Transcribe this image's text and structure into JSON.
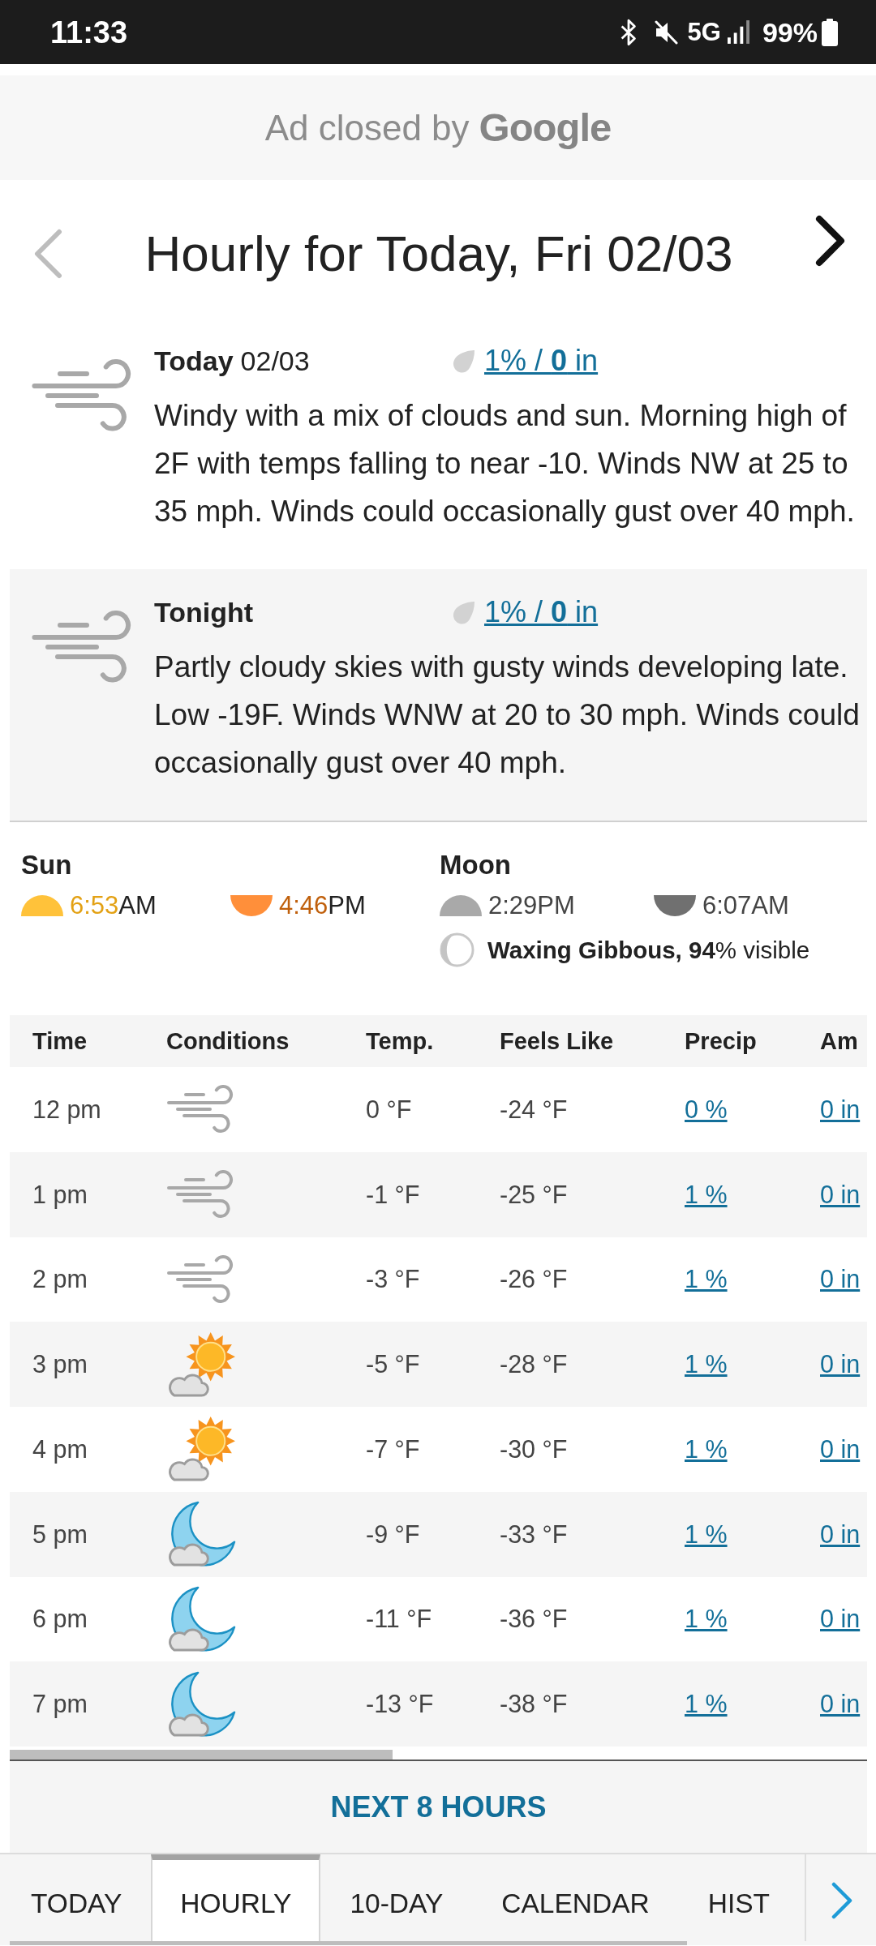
{
  "status_bar": {
    "time": "11:33",
    "network": "5G",
    "battery": "99%"
  },
  "ad_notice": {
    "text": "Ad closed by",
    "brand": "Google"
  },
  "header": {
    "title": "Hourly for Today, Fri 02/03"
  },
  "periods": [
    {
      "kind": "wind",
      "name": "Today",
      "date": "02/03",
      "precip": "1% / **0** in",
      "description": "Windy with a mix of clouds and sun. Morning high of 2F with temps falling to near -10. Winds NW at 25 to 35 mph. Winds could occasionally gust over 40 mph."
    },
    {
      "kind": "wind",
      "name": "Tonight",
      "precip": "1% / **0** in",
      "description": "Partly cloudy skies with gusty winds developing late. Low -19F. Winds WNW at 20 to 30 mph. Winds could occasionally gust over 40 mph."
    }
  ],
  "sun": {
    "title": "Sun",
    "rise": {
      "time": "6:53",
      "suffix": "AM"
    },
    "set": {
      "time": "4:46",
      "suffix": "PM"
    }
  },
  "moon": {
    "title": "Moon",
    "rise": {
      "time": "2:29",
      "suffix": "PM"
    },
    "set": {
      "time": "6:07",
      "suffix": "AM"
    },
    "phase": "**Waxing Gibbous, 94**% visible"
  },
  "table": {
    "columns": [
      "Time",
      "Conditions",
      "Temp.",
      "Feels Like",
      "Precip",
      "Am"
    ],
    "rows": [
      {
        "time": "12 pm",
        "kind": "wind",
        "temp": "0 °F",
        "feels_like": "-24 °F",
        "precip": "0 %",
        "amount": "0 in"
      },
      {
        "time": "1 pm",
        "kind": "wind",
        "temp": "-1 °F",
        "feels_like": "-25 °F",
        "precip": "1 %",
        "amount": "0 in"
      },
      {
        "time": "2 pm",
        "kind": "wind",
        "temp": "-3 °F",
        "feels_like": "-26 °F",
        "precip": "1 %",
        "amount": "0 in"
      },
      {
        "time": "3 pm",
        "kind": "sun-cloud",
        "temp": "-5 °F",
        "feels_like": "-28 °F",
        "precip": "1 %",
        "amount": "0 in"
      },
      {
        "time": "4 pm",
        "kind": "sun-cloud",
        "temp": "-7 °F",
        "feels_like": "-30 °F",
        "precip": "1 %",
        "amount": "0 in"
      },
      {
        "time": "5 pm",
        "kind": "moon-cloud",
        "temp": "-9 °F",
        "feels_like": "-33 °F",
        "precip": "1 %",
        "amount": "0 in"
      },
      {
        "time": "6 pm",
        "kind": "moon-cloud",
        "temp": "-11 °F",
        "feels_like": "-36 °F",
        "precip": "1 %",
        "amount": "0 in"
      },
      {
        "time": "7 pm",
        "kind": "moon-cloud",
        "temp": "-13 °F",
        "feels_like": "-38 °F",
        "precip": "1 %",
        "amount": "0 in"
      }
    ]
  },
  "next_button": "NEXT 8 HOURS",
  "bottom_tabs": [
    {
      "label": "TODAY",
      "selected": false
    },
    {
      "label": "HOURLY",
      "selected": true
    },
    {
      "label": "10-DAY",
      "selected": false
    },
    {
      "label": "CALENDAR",
      "selected": false
    },
    {
      "label": "HIST",
      "selected": false
    }
  ]
}
